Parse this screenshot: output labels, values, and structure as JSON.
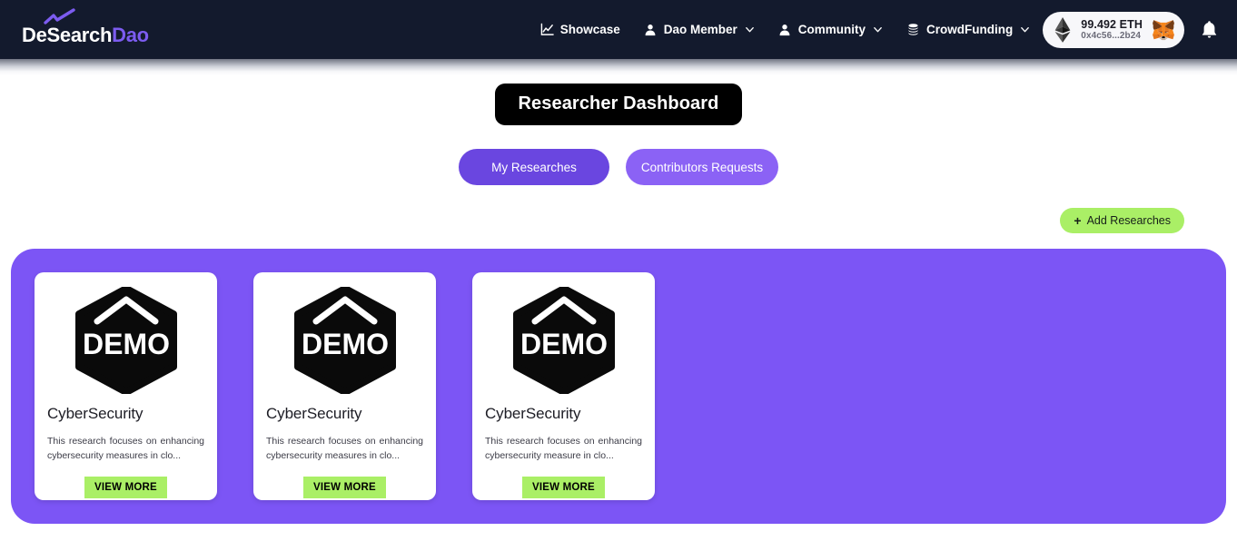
{
  "navbar": {
    "logo": {
      "part1": "DeSearch",
      "part2": "Dao",
      "swoosh_icon": "check-swoosh-icon"
    },
    "links": [
      {
        "label": "Showcase",
        "icon": "line-chart-icon",
        "has_chevron": false
      },
      {
        "label": "Dao Member",
        "icon": "user-icon",
        "has_chevron": true
      },
      {
        "label": "Community",
        "icon": "user-icon",
        "has_chevron": true
      },
      {
        "label": "CrowdFunding",
        "icon": "coins-icon",
        "has_chevron": true
      }
    ],
    "wallet": {
      "balance": "99.492 ETH",
      "address": "0x4c56...2b24",
      "chain_icon": "ethereum-icon",
      "provider_icon": "metamask-fox-icon"
    },
    "notifications_icon": "bell-icon"
  },
  "page": {
    "title": "Researcher Dashboard",
    "tabs": [
      {
        "label": "My Researches",
        "active": true
      },
      {
        "label": "Contributors Requests",
        "active": false
      }
    ],
    "add_button": {
      "plus": "+",
      "label": "Add Researches"
    },
    "cards": [
      {
        "logo_text": "DEMO",
        "title": "CyberSecurity",
        "description": "This research focuses on enhancing cybersecurity measures in clo...",
        "action_label": "VIEW MORE"
      },
      {
        "logo_text": "DEMO",
        "title": "CyberSecurity",
        "description": "This research focuses on enhancing cybersecurity measures in clo...",
        "action_label": "VIEW MORE"
      },
      {
        "logo_text": "DEMO",
        "title": "CyberSecurity",
        "description": "This research focuses on enhancing cybersecurity measure in clo...",
        "action_label": "VIEW MORE"
      }
    ]
  },
  "colors": {
    "navbar_bg": "#131a2d",
    "band_purple": "#7c55f5",
    "tab_active": "#6a46e0",
    "tab_inactive": "#8b62f5",
    "accent_green": "#aaef66",
    "logo_purple": "#7c5cf0"
  }
}
